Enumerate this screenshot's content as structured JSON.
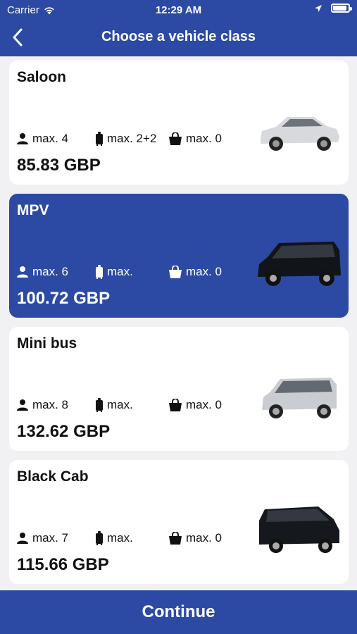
{
  "status_bar": {
    "carrier": "Carrier",
    "time": "12:29 AM"
  },
  "header": {
    "title": "Choose a vehicle class"
  },
  "vehicles": [
    {
      "name": "Saloon",
      "passengers": "max. 4",
      "luggage": "max. 2+2",
      "hand_luggage": "max. 0",
      "price": "85.83 GBP",
      "car_color": "#d7d9dc"
    },
    {
      "name": "MPV",
      "passengers": "max. 6",
      "luggage": "max.",
      "hand_luggage": "max. 0",
      "price": "100.72 GBP",
      "car_color": "#111418"
    },
    {
      "name": "Mini bus",
      "passengers": "max. 8",
      "luggage": "max.",
      "hand_luggage": "max. 0",
      "price": "132.62 GBP",
      "car_color": "#c9ccd0"
    },
    {
      "name": "Black Cab",
      "passengers": "max. 7",
      "luggage": "max.",
      "hand_luggage": "max. 0",
      "price": "115.66 GBP",
      "car_color": "#15181c"
    }
  ],
  "footer": {
    "continue_label": "Continue"
  },
  "colors": {
    "accent": "#2c4aa4",
    "card": "#ffffff",
    "background": "#f1f1f3"
  }
}
